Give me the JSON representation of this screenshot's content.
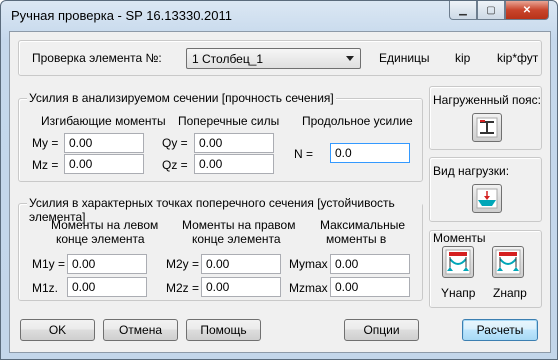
{
  "window": {
    "title": "Ручная проверка - SP 16.13330.2011"
  },
  "header": {
    "element_label": "Проверка элемента №:",
    "element_value": "1 Столбец_1",
    "units_label": "Единицы",
    "unit_force": "kip",
    "unit_moment": "kip*фут"
  },
  "section_forces": {
    "title": "Усилия в анализируемом сечении [прочность сечения]",
    "bending_title": "Изгибающие моменты",
    "shear_title": "Поперечные силы",
    "axial_title": "Продольное усилие",
    "my_label": "My =",
    "my_value": "0.00",
    "mz_label": "Mz =",
    "mz_value": "0.00",
    "qy_label": "Qy =",
    "qy_value": "0.00",
    "qz_label": "Qz =",
    "qz_value": "0.00",
    "n_label": "N =",
    "n_value": "0.0"
  },
  "characteristic_points": {
    "title": "Усилия в характерных точках поперечного сечения [устойчивость элемента]",
    "left_title_1": "Моменты на левом",
    "left_title_2": "конце элемента",
    "right_title_1": "Моменты на правом",
    "right_title_2": "конце элемента",
    "max_title_1": "Максимальные",
    "max_title_2": "моменты в",
    "m1y_label": "M1y =",
    "m1y_value": "0.00",
    "m1z_label": "M1z.",
    "m1z_value": "0.00",
    "m2y_label": "M2y =",
    "m2y_value": "0.00",
    "m2z_label": "M2z =",
    "m2z_value": "0.00",
    "mymax_label": "Mymax =",
    "mymax_value": "0.00",
    "mzmax_label": "Mzmax =",
    "mzmax_value": "0.00"
  },
  "right_panel": {
    "loaded_flange_label": "Нагруженный пояс:",
    "load_type_label": "Вид нагрузки:",
    "moments_label": "Моменты",
    "y_label": "Yнапр",
    "z_label": "Zнапр"
  },
  "footer": {
    "ok": "OK",
    "cancel": "Отмена",
    "help": "Помощь",
    "options": "Опции",
    "calculate": "Расчеты"
  },
  "colors": {
    "accent": "#3399ff",
    "icon_teal": "#00a6b8",
    "icon_red": "#d42020"
  }
}
